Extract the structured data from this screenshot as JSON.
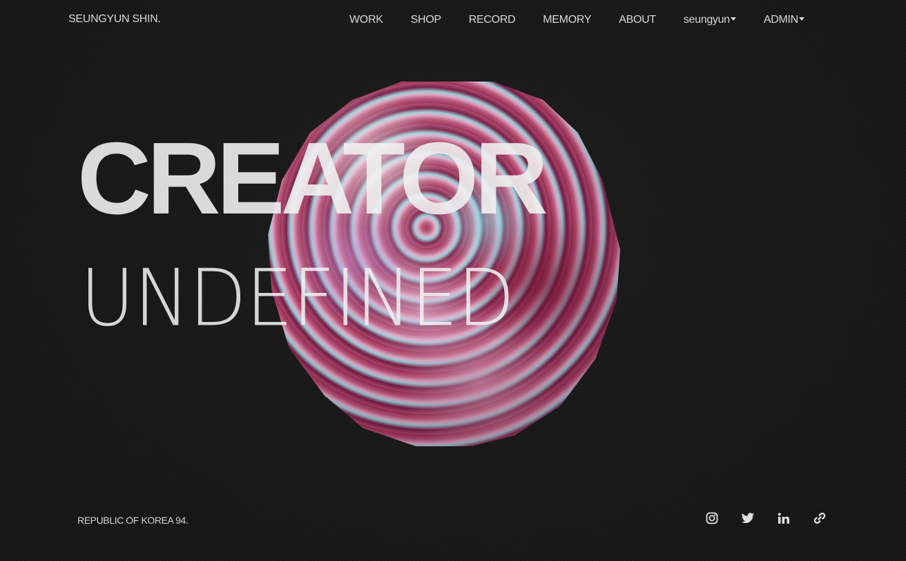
{
  "brand": "SEUNGYUN SHIN.",
  "nav": {
    "items": [
      {
        "label": "WORK"
      },
      {
        "label": "SHOP"
      },
      {
        "label": "RECORD"
      },
      {
        "label": "MEMORY"
      },
      {
        "label": "ABOUT"
      },
      {
        "label": "seungyun",
        "dropdown": true
      },
      {
        "label": "ADMIN",
        "dropdown": true
      }
    ]
  },
  "hero": {
    "line1": "CREATOR",
    "line2": "UNDEFINED"
  },
  "footer": {
    "location": "REPUBLIC OF KOREA 94."
  },
  "social": [
    "instagram-icon",
    "twitter-icon",
    "linkedin-icon",
    "link-icon"
  ],
  "colors": {
    "background": "#151515",
    "text": "#e6e6e6",
    "orb_primary": "#9e2d55",
    "orb_highlight": "#9fd6e4"
  }
}
